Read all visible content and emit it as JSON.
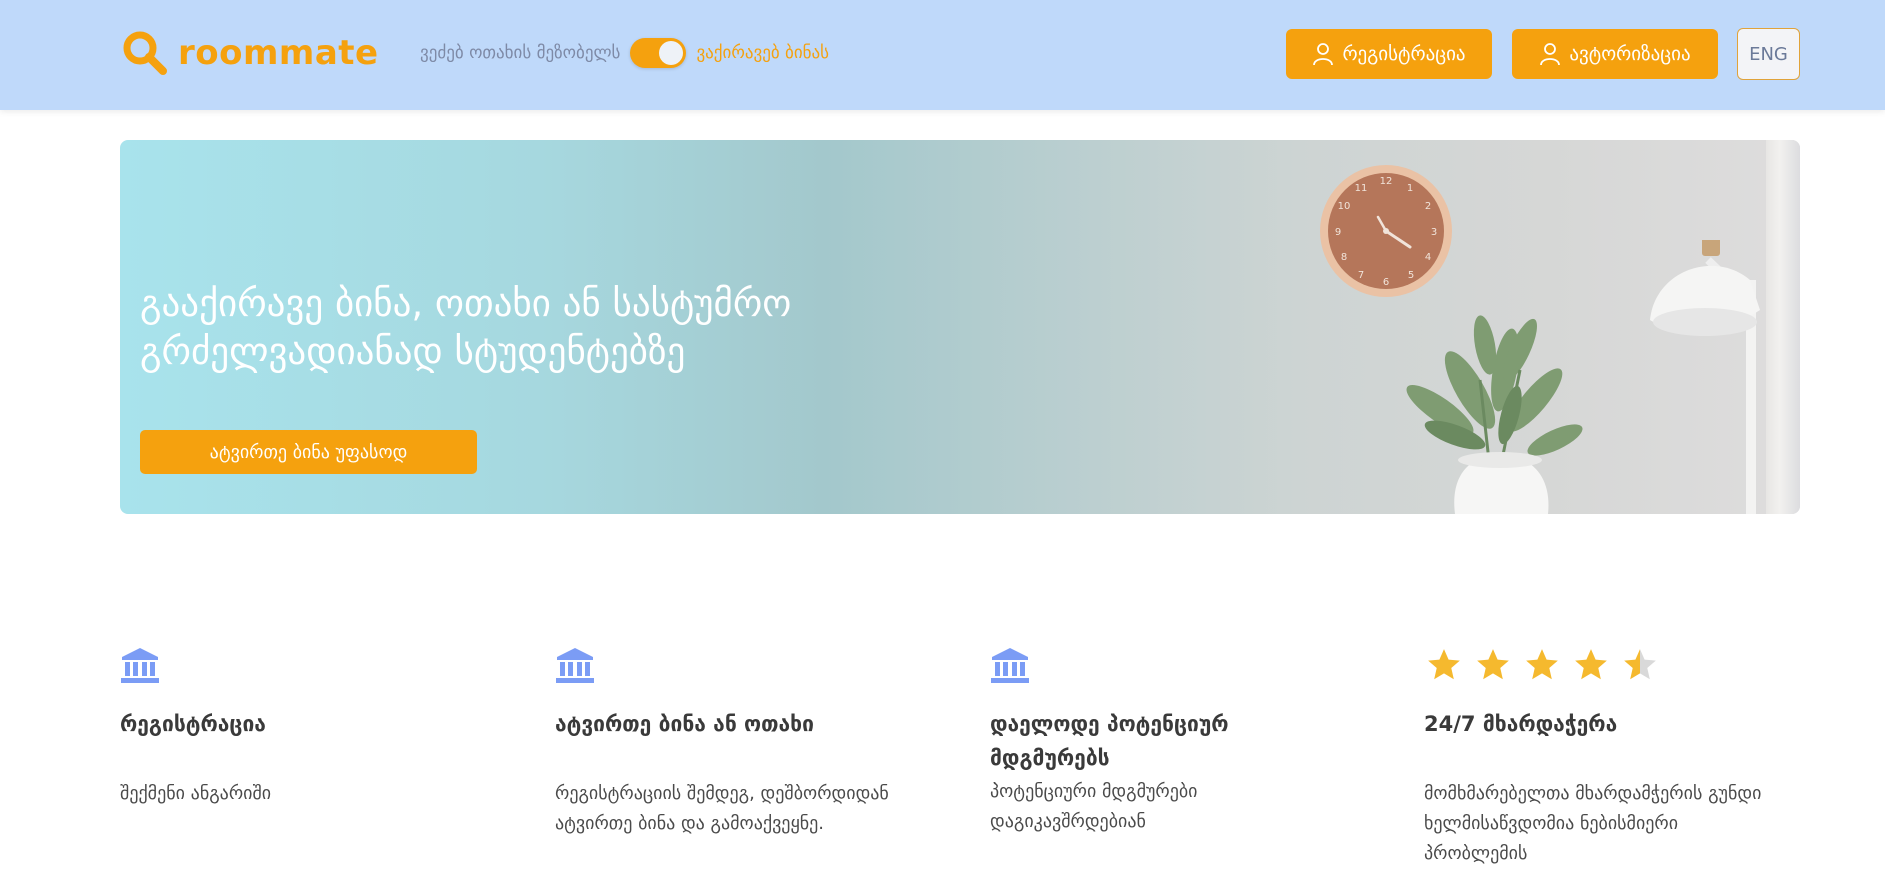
{
  "header": {
    "logo_text": "roommate",
    "mode_left_label": "ვეძებ ოთახის მეზობელს",
    "mode_right_label": "ვაქირავებ ბინას",
    "register_label": "რეგისტრაცია",
    "login_label": "ავტორიზაცია",
    "language_label": "ENG"
  },
  "hero": {
    "title_line1": "გააქირავე ბინა, ოთახი ან სასტუმრო",
    "title_line2": "გრძელვადიანად სტუდენტებზე",
    "cta_label": "ატვირთე ბინა უფასოდ"
  },
  "features": [
    {
      "icon": "bank-icon",
      "title": "რეგისტრაცია",
      "description": "შექმენი ანგარიში"
    },
    {
      "icon": "bank-icon",
      "title": "ატვირთე ბინა ან ოთახი",
      "description": "რეგისტრაციის შემდეგ, დეშბორდიდან ატვირთე ბინა და გამოაქვეყნე."
    },
    {
      "icon": "bank-icon",
      "title": "დაელოდე პოტენციურ მდგმურებს",
      "description": "პოტენციური მდგმურები დაგიკავშრდებიან"
    },
    {
      "icon": "star-rating-icon",
      "rating": 4.5,
      "title": "24/7 მხარდაჭერა",
      "description": "მომხმარებელთა მხარდამჭერის გუნდი ხელმისაწვდომია ნებისმიერი პრობლემის"
    }
  ],
  "colors": {
    "accent": "#f5a10e",
    "header_bg": "#bfd9fa",
    "feature_icon": "#7b9cf5",
    "star": "#f5b92e"
  }
}
